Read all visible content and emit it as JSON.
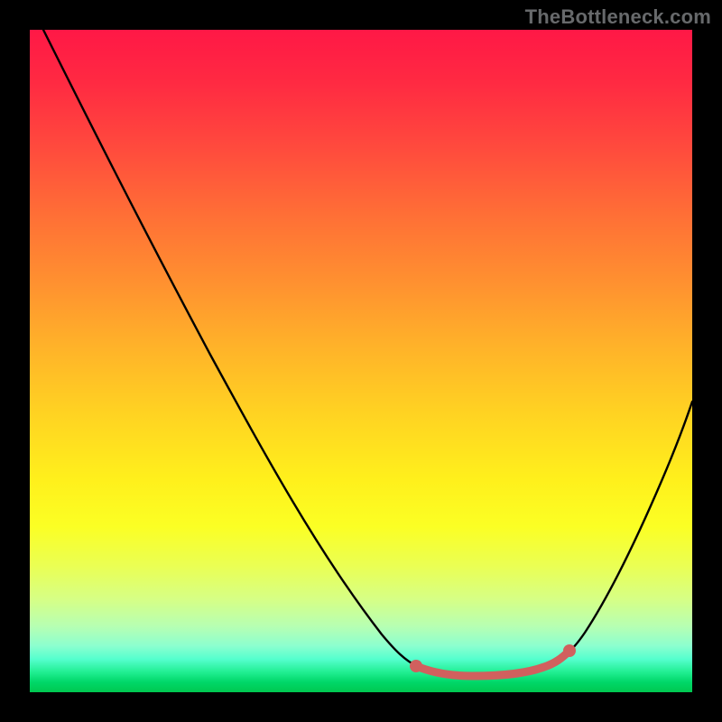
{
  "watermark": "TheBottleneck.com",
  "chart_data": {
    "type": "line",
    "title": "",
    "subtitle": "",
    "xlabel": "",
    "ylabel": "",
    "xlim": [
      0,
      100
    ],
    "ylim": [
      0,
      100
    ],
    "grid": false,
    "legend": false,
    "series": [
      {
        "name": "bottleneck-curve",
        "x": [
          0,
          5,
          10,
          15,
          20,
          25,
          30,
          35,
          40,
          45,
          50,
          55,
          58,
          60,
          62,
          65,
          68,
          71,
          74,
          77,
          80,
          82,
          85,
          88,
          91,
          94,
          97,
          100
        ],
        "y": [
          100,
          92,
          83.5,
          75,
          66.5,
          58,
          49.5,
          41,
          32.5,
          24,
          16,
          9.5,
          6.5,
          5,
          4,
          3,
          2.3,
          2,
          2,
          2.3,
          3.5,
          5,
          8,
          13,
          19,
          26,
          34,
          44
        ]
      }
    ],
    "highlight": {
      "name": "optimal-range",
      "color": "#d1605e",
      "x": [
        58,
        82
      ],
      "y": [
        6.5,
        5
      ]
    }
  },
  "colors": {
    "background": "#000000",
    "curve": "#000000",
    "highlight": "#d1605e"
  }
}
